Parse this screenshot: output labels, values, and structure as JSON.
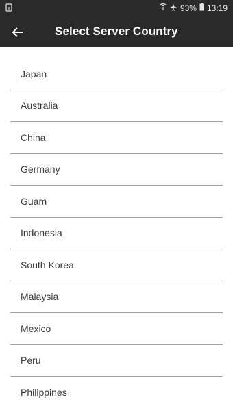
{
  "status_bar": {
    "battery": "93%",
    "time": "13:19",
    "icons": [
      "notification-icon",
      "signal-icon",
      "airplane-icon",
      "battery-icon"
    ]
  },
  "app_bar": {
    "title": "Select Server Country",
    "back_icon": "back-arrow-icon"
  },
  "countries": [
    "Japan",
    "Australia",
    "China",
    "Germany",
    "Guam",
    "Indonesia",
    "South Korea",
    "Malaysia",
    "Mexico",
    "Peru",
    "Philippines"
  ],
  "colors": {
    "bar_background": "#2a2a2a",
    "divider": "#9e9e9e",
    "text": "#3a3a3a"
  }
}
